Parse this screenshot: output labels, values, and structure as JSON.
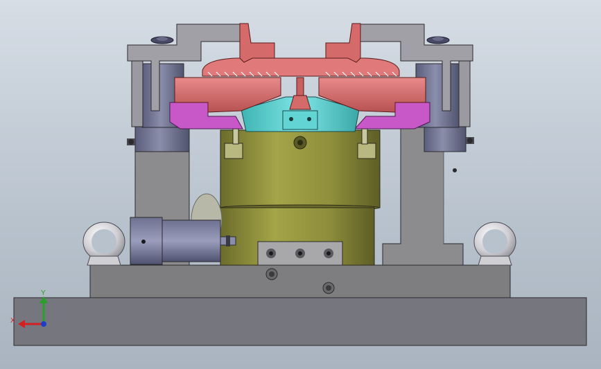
{
  "viewport": {
    "background_top": "#d6dde5",
    "background_bottom": "#aab4c0"
  },
  "triad": {
    "x_label": "X",
    "y_label": "Y",
    "x_color": "#d42020",
    "y_color": "#2aa02a",
    "z_color": "#1e3cc8"
  },
  "colors": {
    "base_plate": "#76767e",
    "mid_plate": "#7e7e80",
    "support": "#8c8c8e",
    "olive_body": "#8a8a3c",
    "cyan_hub": "#5ccfcf",
    "magenta_block": "#c858c8",
    "salmon_jaw": "#d46a6a",
    "bracket": "#9a9aa0",
    "cylinder_blue": "#6e7290",
    "eyebolt": "#d4d4d8"
  }
}
